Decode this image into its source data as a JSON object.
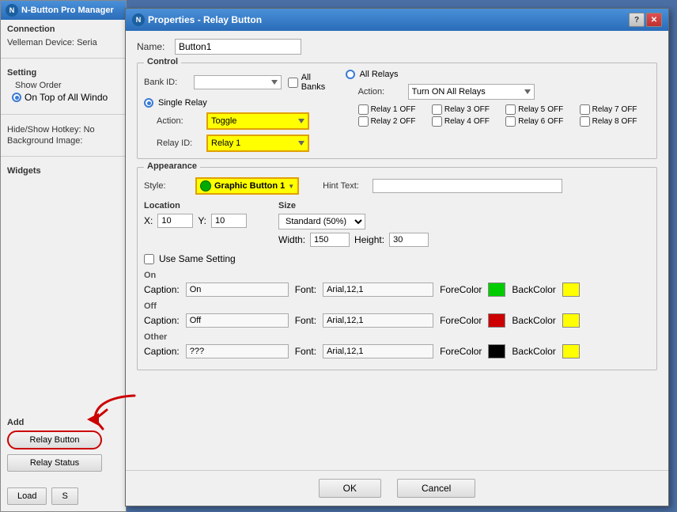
{
  "app": {
    "title": "N-Button Pro Manager",
    "dialog_title": "Properties - Relay Button",
    "icon_letter": "N"
  },
  "left_panel": {
    "connection_label": "Connection",
    "velleman_label": "Velleman Device:",
    "velleman_value": "Seria",
    "setting_label": "Setting",
    "show_order_label": "Show Order",
    "on_top_label": "On Top of All Windo",
    "hotkey_label": "Hide/Show Hotkey:",
    "hotkey_value": "No",
    "bg_label": "Background Image:",
    "widgets_label": "Widgets",
    "add_label": "Add",
    "relay_button_label": "Relay Button",
    "relay_status_label": "Relay Status",
    "load_btn": "Load",
    "save_btn": "S"
  },
  "dialog": {
    "name_label": "Name:",
    "name_value": "Button1",
    "control_label": "Control",
    "bank_id_label": "Bank ID:",
    "all_banks_label": "All Banks",
    "single_relay_label": "Single Relay",
    "all_relays_label": "All Relays",
    "action_label": "Action:",
    "relay_id_label": "Relay ID:",
    "action_value": "Toggle",
    "relay_id_value": "Relay 1",
    "all_action_value": "Turn ON All Relays",
    "relays": [
      "Relay 1",
      "Relay 2",
      "Relay 3",
      "Relay 4",
      "Relay 5",
      "Relay 6",
      "Relay 7",
      "Relay 8"
    ],
    "relay_states": [
      "OFF",
      "OFF",
      "OFF",
      "OFF",
      "OFF",
      "OFF",
      "OFF",
      "OFF"
    ],
    "appearance_label": "Appearance",
    "style_label": "Style:",
    "style_value": "Graphic Button 1",
    "hint_text_label": "Hint Text:",
    "location_label": "Location",
    "x_label": "X:",
    "x_value": "10",
    "y_label": "Y:",
    "y_value": "10",
    "size_label": "Size",
    "size_value": "Standard (50%)",
    "width_label": "Width:",
    "width_value": "150",
    "height_label": "Height:",
    "height_value": "30",
    "use_same_setting_label": "Use Same Setting",
    "on_label": "On",
    "on_caption": "On",
    "on_font": "Arial,12,1",
    "on_forecolor_label": "ForeColor",
    "on_backcolor_label": "BackColor",
    "off_label": "Off",
    "off_caption": "Off",
    "off_font": "Arial,12,1",
    "off_forecolor_label": "ForeColor",
    "off_backcolor_label": "BackColor",
    "other_label": "Other",
    "other_caption": "???",
    "other_font": "Arial,12,1",
    "other_forecolor_label": "ForeColor",
    "other_backcolor_label": "BackColor",
    "caption_label": "Caption:",
    "font_label": "Font:",
    "ok_label": "OK",
    "cancel_label": "Cancel"
  }
}
